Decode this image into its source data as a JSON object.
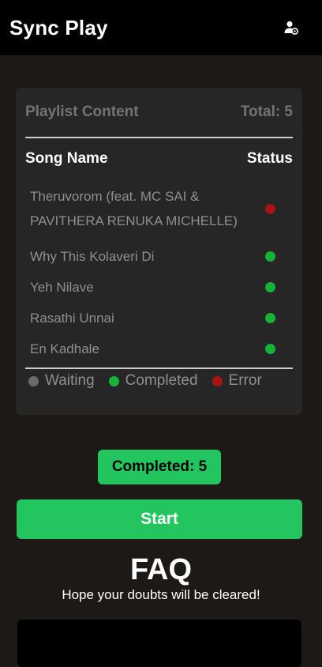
{
  "app": {
    "title": "Sync Play"
  },
  "header": {
    "user_icon": "user-settings-icon"
  },
  "playlist": {
    "heading": "Playlist Content",
    "total_label": "Total: 5",
    "col_song": "Song Name",
    "col_status": "Status",
    "songs": [
      {
        "name": "Theruvorom (feat. MC SAI & PAVITHERA RENUKA MICHELLE)",
        "status": "error"
      },
      {
        "name": "Why This Kolaveri Di",
        "status": "completed"
      },
      {
        "name": "Yeh Nilave",
        "status": "completed"
      },
      {
        "name": "Rasathi Unnai",
        "status": "completed"
      },
      {
        "name": "En Kadhale",
        "status": "completed"
      }
    ],
    "legend": [
      {
        "label": "Waiting",
        "status": "waiting"
      },
      {
        "label": "Completed",
        "status": "completed"
      },
      {
        "label": "Error",
        "status": "error"
      }
    ]
  },
  "colors": {
    "waiting": "#6b6b6b",
    "completed": "#16b336",
    "error": "#a81414",
    "accent": "#22c55e",
    "background": "#1c1917"
  },
  "completed_badge": "Completed: 5",
  "start_button": "Start",
  "faq": {
    "title": "FAQ",
    "subtitle": "Hope your doubts will be cleared!"
  }
}
